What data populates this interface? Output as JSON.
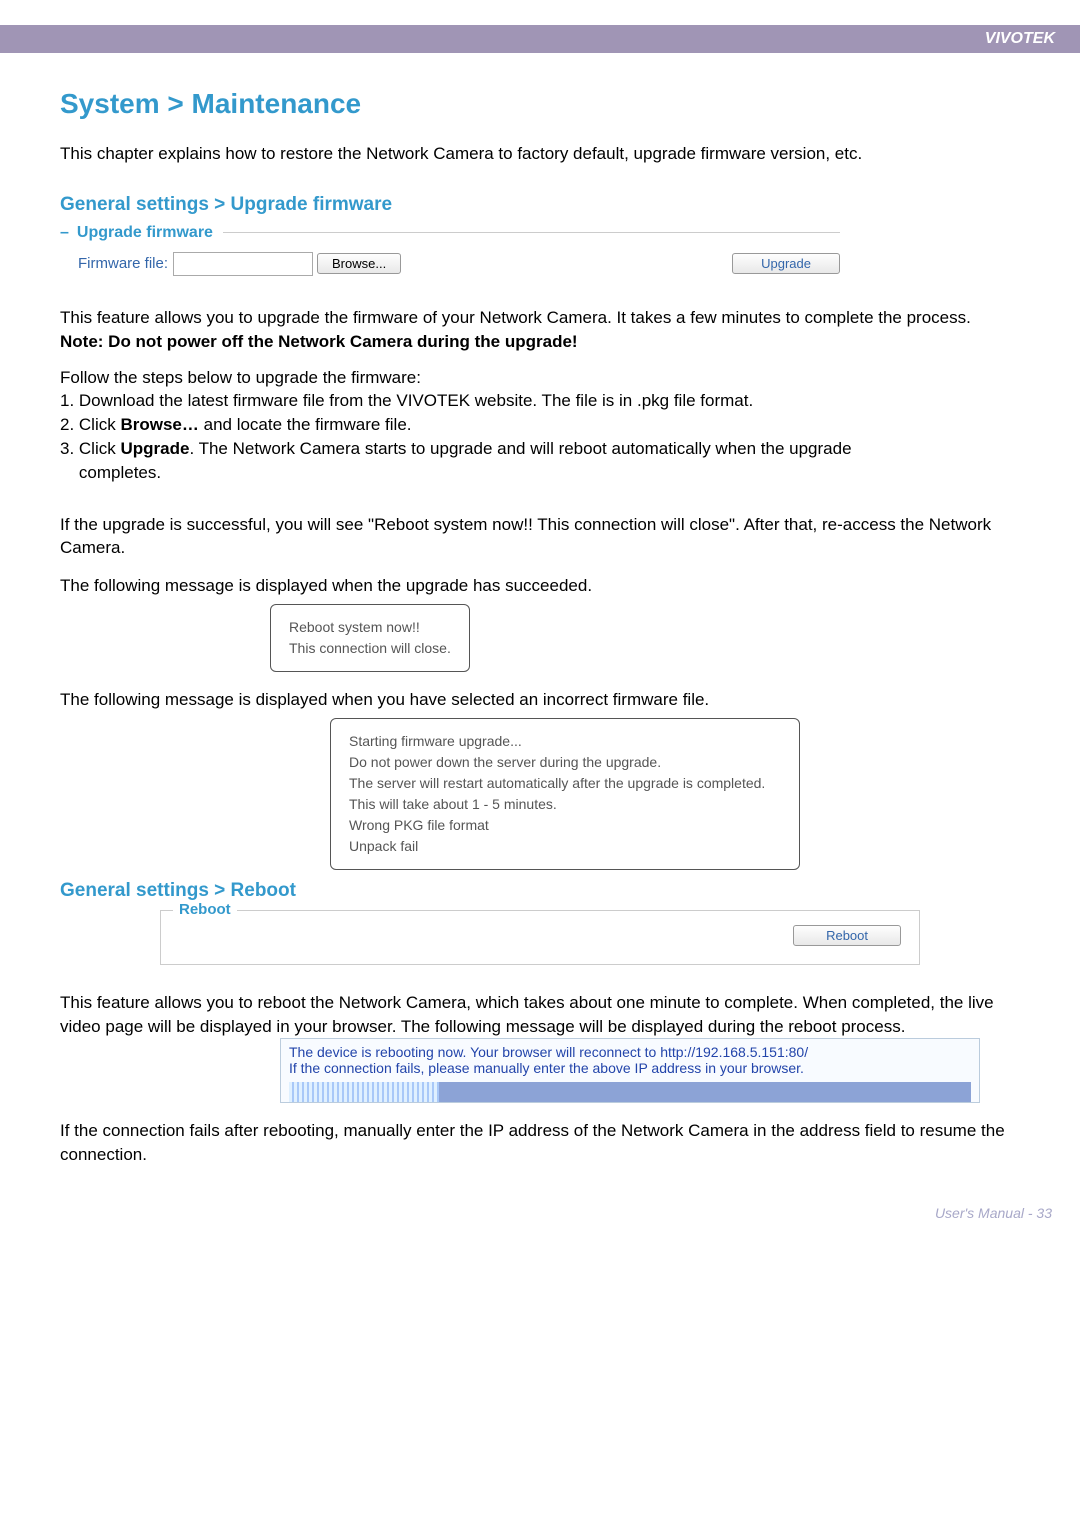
{
  "brand": "VIVOTEK",
  "page_title": "System > Maintenance",
  "intro": "This chapter explains how to restore the Network Camera to factory default, upgrade firmware version, etc.",
  "upgrade_section": {
    "title": "General settings > Upgrade firmware",
    "legend": "Upgrade firmware",
    "firmware_label": "Firmware file:",
    "browse_btn": "Browse...",
    "upgrade_btn": "Upgrade"
  },
  "upgrade_desc": "This feature allows you to upgrade the firmware of your Network Camera. It takes a few minutes to complete the process.",
  "upgrade_note": "Note: Do not power off the Network Camera during the upgrade!",
  "steps_intro": "Follow the steps below to upgrade the firmware:",
  "steps": [
    "1. Download the latest firmware file from the VIVOTEK website. The file is in .pkg file format.",
    "2. Click Browse… and locate the firmware file.",
    "3. Click Upgrade. The Network Camera starts to upgrade and will reboot automatically when the upgrade completes."
  ],
  "success_intro": "If the upgrade is successful, you will see \"Reboot system now!! This connection will close\". After that, re-access the Network Camera.",
  "success_msg_intro": "The following message is displayed when the upgrade has succeeded.",
  "success_msg": "Reboot system now!!\nThis connection will close.",
  "fail_msg_intro": "The following message is displayed when you have selected an incorrect firmware file.",
  "fail_msg": "Starting firmware upgrade...\nDo not power down the server during the upgrade.\nThe server will restart automatically after the upgrade is completed.\nThis will take about 1 - 5 minutes.\nWrong PKG file format\nUnpack fail",
  "reboot_section": {
    "title": "General settings > Reboot",
    "legend": "Reboot",
    "reboot_btn": "Reboot"
  },
  "reboot_desc": "This feature allows you to reboot the Network Camera, which takes about one minute to complete. When completed, the live video page will be displayed in your browser. The following message will be displayed during the reboot process.",
  "rebooting_msg": {
    "line1": "The device is rebooting now. Your browser will reconnect to http://192.168.5.151:80/",
    "line2": "If the connection fails, please manually enter the above IP address in your browser."
  },
  "reboot_fail": "If the connection fails after rebooting, manually enter the IP address of the Network Camera in the address field to resume the connection.",
  "footer": "User's Manual - 33"
}
